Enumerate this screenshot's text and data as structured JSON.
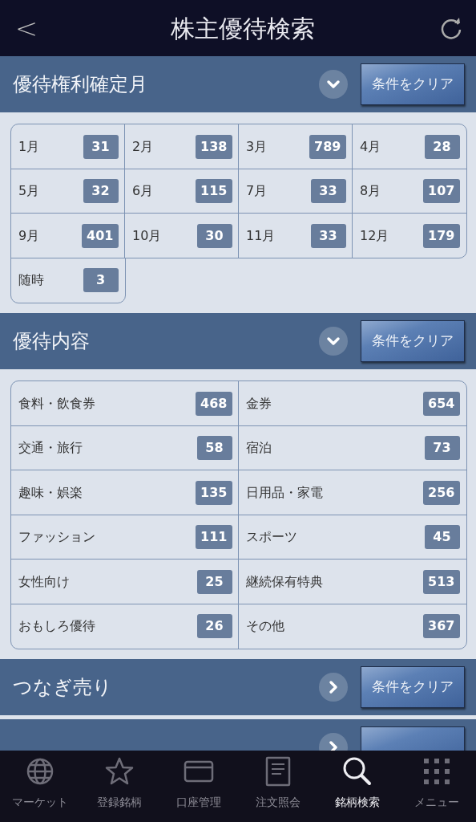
{
  "header": {
    "back": "<",
    "title": "株主優待検索"
  },
  "sections": [
    {
      "title": "優待権利確定月",
      "expanded": true,
      "clear": "条件をクリア",
      "kind": "months",
      "items": [
        {
          "label": "1月",
          "count": "31"
        },
        {
          "label": "2月",
          "count": "138"
        },
        {
          "label": "3月",
          "count": "789"
        },
        {
          "label": "4月",
          "count": "28"
        },
        {
          "label": "5月",
          "count": "32"
        },
        {
          "label": "6月",
          "count": "115"
        },
        {
          "label": "7月",
          "count": "33"
        },
        {
          "label": "8月",
          "count": "107"
        },
        {
          "label": "9月",
          "count": "401"
        },
        {
          "label": "10月",
          "count": "30"
        },
        {
          "label": "11月",
          "count": "33"
        },
        {
          "label": "12月",
          "count": "179"
        },
        {
          "label": "随時",
          "count": "3"
        }
      ]
    },
    {
      "title": "優待内容",
      "expanded": true,
      "clear": "条件をクリア",
      "kind": "categories",
      "items": [
        {
          "label": "食料・飲食券",
          "count": "468"
        },
        {
          "label": "金券",
          "count": "654"
        },
        {
          "label": "交通・旅行",
          "count": "58"
        },
        {
          "label": "宿泊",
          "count": "73"
        },
        {
          "label": "趣味・娯楽",
          "count": "135"
        },
        {
          "label": "日用品・家電",
          "count": "256"
        },
        {
          "label": "ファッション",
          "count": "111"
        },
        {
          "label": "スポーツ",
          "count": "45"
        },
        {
          "label": "女性向け",
          "count": "25"
        },
        {
          "label": "継続保有特典",
          "count": "513"
        },
        {
          "label": "おもしろ優待",
          "count": "26"
        },
        {
          "label": "その他",
          "count": "367"
        }
      ]
    },
    {
      "title": "つなぎ売り",
      "expanded": false,
      "clear": "条件をクリア"
    },
    {
      "expanded": false
    }
  ],
  "tabs": [
    {
      "kind": "globe",
      "label": "マーケット",
      "selected": false
    },
    {
      "kind": "star",
      "label": "登録銘柄",
      "selected": false
    },
    {
      "kind": "card",
      "label": "口座管理",
      "selected": false
    },
    {
      "kind": "document",
      "label": "注文照会",
      "selected": false
    },
    {
      "kind": "search",
      "label": "銘柄検索",
      "selected": true
    },
    {
      "kind": "grid",
      "label": "メニュー",
      "selected": false
    }
  ]
}
